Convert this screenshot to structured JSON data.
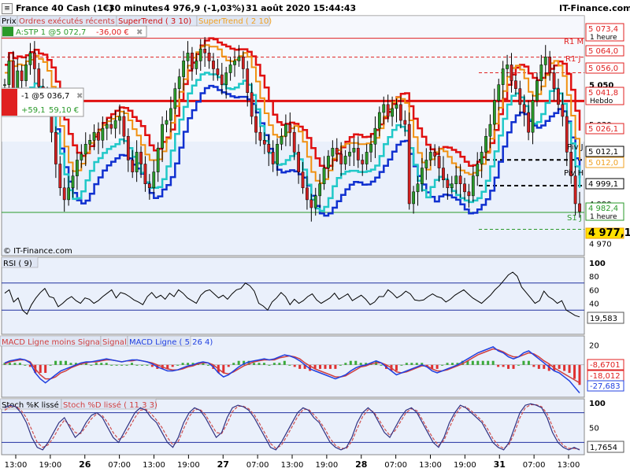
{
  "header": {
    "instrument": "France 40 Cash (1€)",
    "timeframe": "30 minutes",
    "price_info": "4 976,9 (-1,03%)",
    "datetime": "31 août 2020 15:44:43",
    "brand": "IT-Finance.com",
    "menu_icon": "menu-icon"
  },
  "main_panel": {
    "tabs": [
      "Prix",
      "Ordres exécutés récents",
      "SuperTrend ( 3 10)",
      "SuperTrend ( 2 10)"
    ],
    "order_tag": "A:STP 1 @5 072,7",
    "order_pnl": "-36,00 €",
    "position_tag": "-1 @5 036,7",
    "position_pts": "+59,1",
    "position_eur": "59,10 €",
    "watermark": "© IT-Finance.com",
    "level_labels": {
      "r1m": "R1 M",
      "r1j": "R1 J",
      "piv_j": "Piv J",
      "piv_h": "Piv H",
      "s1j": "S1 J"
    },
    "price_tags": [
      {
        "text": "5 073,4",
        "sub": "1 heure",
        "color": "#e02020"
      },
      {
        "text": "5 064,0",
        "sub": "",
        "color": "#e02020"
      },
      {
        "text": "5 056,0",
        "sub": "",
        "color": "#e02020"
      },
      {
        "text": "5 041,8",
        "sub": "Hebdo",
        "color": "#e02020"
      },
      {
        "text": "5 026,1",
        "sub": "",
        "color": "#e02020"
      },
      {
        "text": "5 012,1",
        "sub": "",
        "color": "#000000"
      },
      {
        "text": "5 012,0",
        "sub": "",
        "color": "#f0a020"
      },
      {
        "text": "4 999,1",
        "sub": "",
        "color": "#000000"
      },
      {
        "text": "4 982,4",
        "sub": "1 heure",
        "color": "#2a9a2a"
      },
      {
        "text": "4 977,1",
        "sub": "",
        "color": "#f0a000"
      }
    ],
    "y_ticks": [
      "5 050",
      "5 030",
      "4 990",
      "4 970"
    ]
  },
  "rsi_panel": {
    "title": "RSI ( 9)",
    "value": "19,583",
    "y_ticks": [
      "100",
      "80",
      "60",
      "40",
      "20"
    ]
  },
  "macd_panel": {
    "titles": [
      "MACD Ligne moins Signal",
      "Signal",
      "MACD Ligne ( 5 26 4)"
    ],
    "values": [
      "-8,6701",
      "-18,012",
      "-27,683"
    ],
    "y_ticks": [
      "20",
      "0",
      "-20"
    ]
  },
  "stoch_panel": {
    "titles": [
      "Stoch %K lissé",
      "Stoch %D lissé ( 11 3 3)"
    ],
    "value": "1,7654",
    "y_ticks": [
      "100",
      "50"
    ]
  },
  "x_axis": {
    "ticks": [
      {
        "label": "13:00",
        "bold": false
      },
      {
        "label": "19:00",
        "bold": false
      },
      {
        "label": "26",
        "bold": true
      },
      {
        "label": "07:00",
        "bold": false
      },
      {
        "label": "13:00",
        "bold": false
      },
      {
        "label": "19:00",
        "bold": false
      },
      {
        "label": "27",
        "bold": true
      },
      {
        "label": "07:00",
        "bold": false
      },
      {
        "label": "13:00",
        "bold": false
      },
      {
        "label": "19:00",
        "bold": false
      },
      {
        "label": "28",
        "bold": true
      },
      {
        "label": "07:00",
        "bold": false
      },
      {
        "label": "13:00",
        "bold": false
      },
      {
        "label": "19:00",
        "bold": false
      },
      {
        "label": "31",
        "bold": true
      },
      {
        "label": "07:00",
        "bold": false
      },
      {
        "label": "13:00",
        "bold": false
      }
    ]
  },
  "colors": {
    "panel_bg": "#eaf0fb",
    "candle_up": "#2a9a2a",
    "candle_down": "#d02020",
    "wick": "#000000",
    "supertrend_red": "#e01010",
    "supertrend_orange": "#f09010",
    "supertrend_blue": "#1030d0",
    "supertrend_cyan": "#20c8c8",
    "rsi_line": "#000000",
    "macd_blue": "#2040e0",
    "macd_signal": "#d04040",
    "stoch_k": "#303080",
    "stoch_d": "#d05050"
  },
  "chart_data": [
    {
      "type": "candlestick",
      "title": "France 40 Cash (1€)",
      "ylim": [
        4965,
        5080
      ],
      "y_ticks": [
        5050,
        5030,
        4990,
        4970
      ],
      "levels": {
        "R1 M": 5073.4,
        "R1 J": 5056.0,
        "Piv J": 5012.1,
        "Piv H": 4999.1,
        "S1 J": 4977.1,
        "Hebdo": 5041.8
      },
      "close": [
        5050,
        5062,
        5048,
        5057,
        5052,
        5060,
        5066,
        5058,
        5049,
        5044,
        5038,
        5026,
        5010,
        4998,
        4992,
        4998,
        5004,
        5012,
        5015,
        5020,
        5022,
        5026,
        5022,
        5028,
        5030,
        5028,
        5032,
        5034,
        5024,
        5012,
        5006,
        5016,
        5010,
        5000,
        4998,
        5006,
        5018,
        5030,
        5032,
        5038,
        5048,
        5054,
        5062,
        5066,
        5058,
        5062,
        5068,
        5066,
        5062,
        5058,
        5055,
        5050,
        5056,
        5060,
        5062,
        5064,
        5058,
        5046,
        5034,
        5026,
        5022,
        5020,
        5016,
        5010,
        5020,
        5024,
        5030,
        5026,
        5016,
        5006,
        4998,
        4992,
        4988,
        4994,
        5000,
        5008,
        5014,
        5018,
        5015,
        5010,
        5014,
        5016,
        5018,
        5012,
        5010,
        5016,
        5020,
        5028,
        5036,
        5040,
        5034,
        5038,
        5040,
        5032,
        5030,
        4990,
        4996,
        5000,
        5008,
        5012,
        5016,
        5014,
        5008,
        5002,
        4998,
        5000,
        5004,
        5000,
        4996,
        4994,
        5004,
        5010,
        5016,
        5024,
        5030,
        5042,
        5050,
        5058,
        5060,
        5052,
        5048,
        5040,
        5036,
        5026,
        5042,
        5052,
        5060,
        5064,
        5056,
        5048,
        5040,
        5034,
        5016,
        5004,
        4990,
        4986
      ]
    },
    {
      "type": "line",
      "title": "RSI ( 9)",
      "ylim": [
        0,
        100
      ],
      "y_ticks": [
        100,
        80,
        60,
        40,
        20
      ],
      "values": [
        55,
        60,
        42,
        48,
        30,
        24,
        38,
        48,
        56,
        62,
        50,
        48,
        35,
        40,
        46,
        50,
        44,
        40,
        48,
        46,
        40,
        44,
        50,
        55,
        60,
        48,
        56,
        54,
        50,
        45,
        42,
        38,
        50,
        56,
        48,
        52,
        46,
        55,
        50,
        60,
        55,
        48,
        44,
        40,
        52,
        58,
        60,
        54,
        48,
        52,
        46,
        54,
        60,
        62,
        70,
        66,
        58,
        40,
        36,
        30,
        42,
        48,
        56,
        50,
        38,
        46,
        40,
        44,
        50,
        54,
        45,
        40,
        44,
        48,
        55,
        46,
        50,
        54,
        44,
        48,
        52,
        46,
        38,
        42,
        50,
        50,
        60,
        55,
        48,
        52,
        58,
        54,
        45,
        44,
        45,
        50,
        54,
        50,
        48,
        42,
        46,
        52,
        56,
        60,
        54,
        48,
        44,
        40,
        46,
        52,
        60,
        66,
        74,
        82,
        86,
        80,
        64,
        56,
        48,
        40,
        44,
        58,
        50,
        46,
        40,
        44,
        30,
        26,
        22,
        20
      ]
    },
    {
      "type": "bar",
      "title": "MACD ( 5 26 4)",
      "ylim": [
        -30,
        25
      ],
      "y_ticks": [
        20,
        0,
        -20
      ],
      "series": [
        {
          "name": "MACD Ligne ( 5 26 4)",
          "values": [
            2,
            4,
            5,
            6,
            5,
            2,
            -8,
            -14,
            -18,
            -14,
            -10,
            -6,
            -4,
            -2,
            0,
            2,
            3,
            3,
            4,
            5,
            6,
            5,
            4,
            3,
            4,
            5,
            5,
            4,
            3,
            1,
            -2,
            -4,
            -6,
            -6,
            -5,
            -3,
            -1,
            0,
            2,
            3,
            2,
            -2,
            -8,
            -12,
            -10,
            -6,
            -2,
            1,
            3,
            4,
            5,
            6,
            5,
            6,
            8,
            10,
            9,
            7,
            4,
            0,
            -4,
            -6,
            -8,
            -10,
            -12,
            -14,
            -12,
            -10,
            -6,
            -3,
            -1,
            0,
            2,
            4,
            2,
            -2,
            -6,
            -10,
            -8,
            -6,
            -4,
            -2,
            0,
            -2,
            -6,
            -8,
            -6,
            -4,
            -2,
            0,
            3,
            6,
            9,
            12,
            14,
            16,
            18,
            14,
            12,
            8,
            6,
            8,
            12,
            14,
            10,
            6,
            2,
            -2,
            -6,
            -8,
            -12,
            -16,
            -22,
            -28
          ]
        },
        {
          "name": "Signal",
          "values": [
            1,
            3,
            4,
            5,
            5,
            3,
            -4,
            -10,
            -14,
            -14,
            -12,
            -8,
            -6,
            -3,
            -1,
            1,
            2,
            3,
            3,
            4,
            5,
            5,
            4,
            3,
            4,
            4,
            5,
            4,
            3,
            2,
            0,
            -2,
            -4,
            -5,
            -5,
            -4,
            -2,
            -1,
            1,
            2,
            2,
            0,
            -4,
            -8,
            -9,
            -7,
            -4,
            -1,
            1,
            3,
            4,
            5,
            5,
            5,
            7,
            8,
            9,
            8,
            6,
            2,
            -1,
            -4,
            -6,
            -8,
            -10,
            -12,
            -12,
            -11,
            -8,
            -5,
            -2,
            -1,
            1,
            2,
            2,
            0,
            -3,
            -7,
            -8,
            -7,
            -5,
            -3,
            -1,
            -1,
            -4,
            -6,
            -6,
            -5,
            -3,
            -1,
            1,
            4,
            7,
            10,
            12,
            14,
            16,
            15,
            13,
            10,
            8,
            8,
            10,
            12,
            11,
            8,
            4,
            1,
            -3,
            -6,
            -9,
            -12,
            -15,
            -18
          ]
        }
      ]
    },
    {
      "type": "line",
      "title": "Stoch %K lissé",
      "ylim": [
        0,
        100
      ],
      "y_ticks": [
        100,
        50
      ],
      "series": [
        {
          "name": "Stoch %K lissé",
          "values": [
            90,
            95,
            92,
            80,
            60,
            30,
            10,
            5,
            20,
            40,
            60,
            70,
            50,
            30,
            40,
            60,
            75,
            80,
            70,
            50,
            30,
            20,
            40,
            60,
            80,
            90,
            85,
            70,
            60,
            40,
            20,
            10,
            30,
            60,
            80,
            90,
            85,
            70,
            50,
            30,
            40,
            70,
            90,
            95,
            92,
            85,
            70,
            50,
            30,
            10,
            5,
            20,
            40,
            60,
            80,
            90,
            85,
            70,
            60,
            40,
            20,
            10,
            5,
            10,
            30,
            60,
            80,
            90,
            80,
            60,
            40,
            30,
            50,
            70,
            85,
            90,
            80,
            60,
            40,
            20,
            10,
            30,
            60,
            80,
            95,
            90,
            80,
            70,
            60,
            40,
            20,
            10,
            5,
            20,
            50,
            80,
            95,
            98,
            95,
            90,
            70,
            40,
            20,
            10,
            5,
            10,
            5
          ]
        },
        {
          "name": "Stoch %D lissé ( 11 3 3)",
          "values": [
            85,
            92,
            93,
            85,
            70,
            45,
            20,
            10,
            15,
            30,
            50,
            65,
            55,
            40,
            38,
            52,
            68,
            78,
            74,
            60,
            40,
            26,
            32,
            50,
            70,
            85,
            87,
            78,
            65,
            50,
            30,
            15,
            22,
            48,
            72,
            86,
            87,
            76,
            58,
            40,
            38,
            58,
            82,
            93,
            93,
            88,
            76,
            58,
            38,
            18,
            8,
            14,
            32,
            52,
            72,
            86,
            87,
            76,
            64,
            48,
            28,
            14,
            8,
            8,
            22,
            48,
            72,
            86,
            82,
            66,
            48,
            34,
            44,
            62,
            80,
            88,
            84,
            66,
            46,
            28,
            14,
            24,
            50,
            74,
            90,
            92,
            84,
            74,
            64,
            48,
            28,
            14,
            8,
            16,
            40,
            70,
            90,
            96,
            96,
            92,
            78,
            52,
            28,
            14,
            8,
            8,
            6
          ]
        }
      ]
    }
  ]
}
